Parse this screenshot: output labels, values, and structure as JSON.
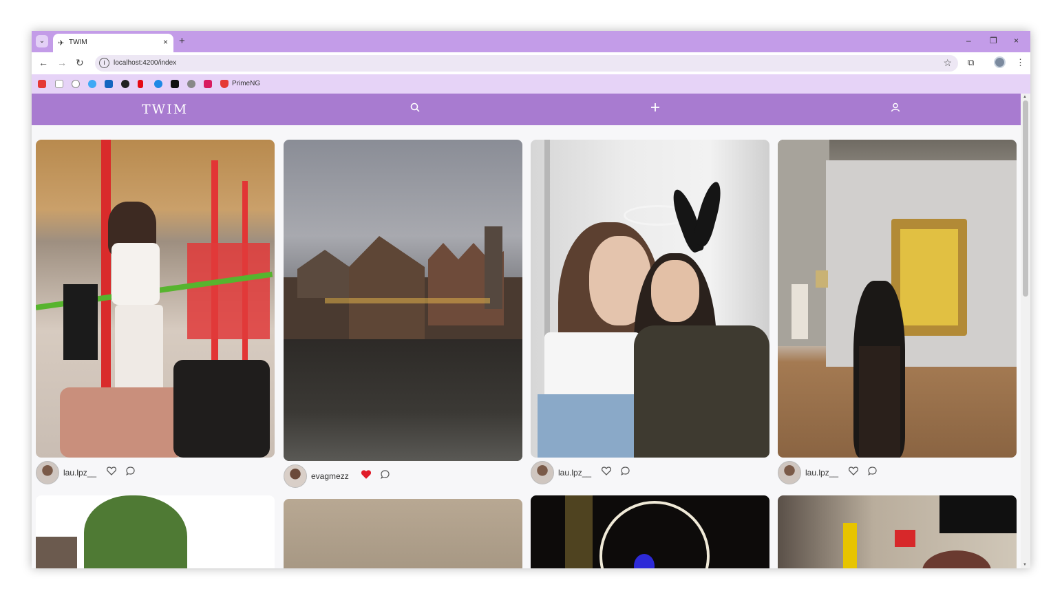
{
  "browser": {
    "tab_title": "TWIM",
    "url": "localhost:4200/index",
    "bookmark_label": "PrimeNG",
    "new_tab": "+",
    "tab_close": "×",
    "window_minimize": "–",
    "window_restore": "❐",
    "window_close": "×"
  },
  "app": {
    "brand": "TWIM",
    "nav_icons": [
      "search-icon",
      "plus-icon",
      "user-icon"
    ],
    "accent_color": "#a87bd0",
    "tab_strip_color": "#c39ce8"
  },
  "posts": [
    {
      "username": "lau.lpz__",
      "liked": false
    },
    {
      "username": "evagmezz",
      "liked": true
    },
    {
      "username": "lau.lpz__",
      "liked": false
    },
    {
      "username": "lau.lpz__",
      "liked": false
    }
  ],
  "colors": {
    "liked_heart": "#e11d2a",
    "unliked_heart": "#555555"
  }
}
